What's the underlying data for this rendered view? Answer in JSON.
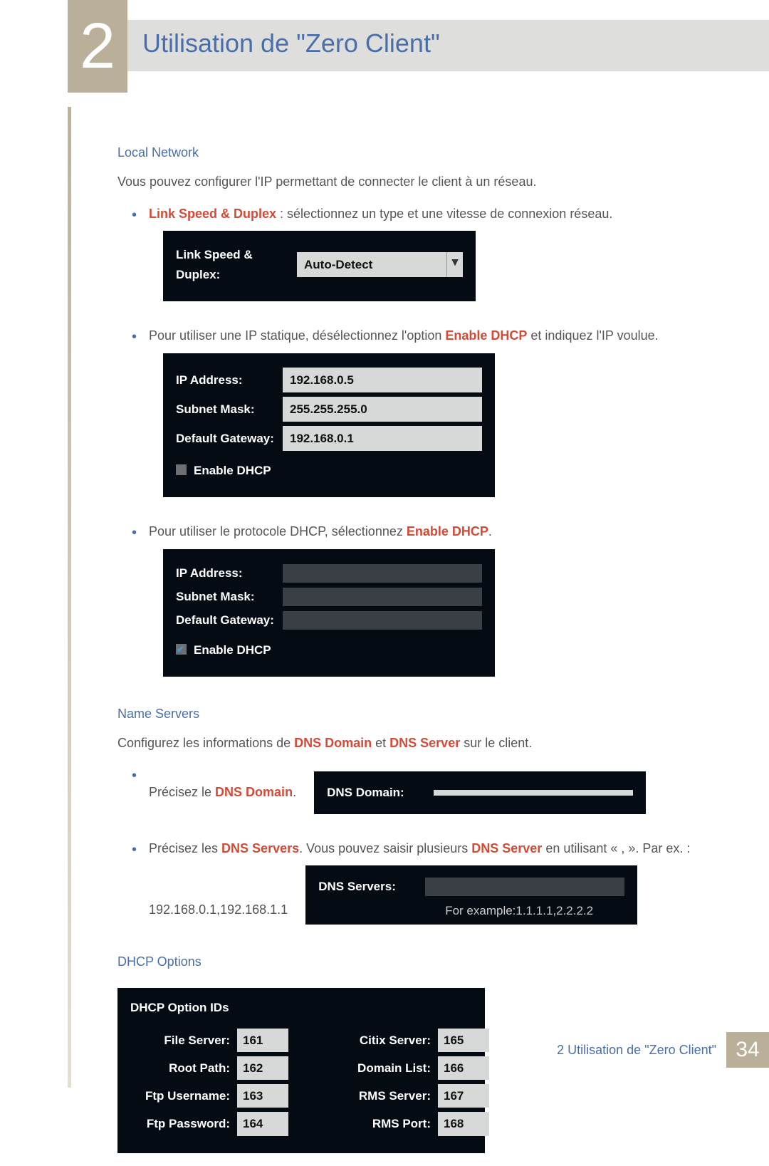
{
  "chapter": {
    "number": "2",
    "title": "Utilisation de \"Zero Client\""
  },
  "section_localnet": {
    "heading": "Local Network",
    "intro": "Vous pouvez configurer l'IP permettant de connecter le client à un réseau.",
    "bullet1_label": "Link Speed & Duplex",
    "bullet1_rest": " : sélectionnez un type et une vitesse de connexion réseau.",
    "ui1": {
      "label": "Link Speed & Duplex:",
      "value": "Auto-Detect"
    },
    "bullet2_pre": "Pour utiliser une IP statique, désélectionnez l'option ",
    "bullet2_red": "Enable DHCP",
    "bullet2_post": " et indiquez l'IP voulue.",
    "ui2": {
      "ip_label": "IP Address:",
      "ip_value": "192.168.0.5",
      "mask_label": "Subnet Mask:",
      "mask_value": "255.255.255.0",
      "gw_label": "Default Gateway:",
      "gw_value": "192.168.0.1",
      "dhcp_label": "Enable DHCP"
    },
    "bullet3_pre": "Pour utiliser le protocole DHCP, sélectionnez ",
    "bullet3_red": "Enable DHCP",
    "bullet3_post": ".",
    "ui3": {
      "ip_label": "IP Address:",
      "mask_label": "Subnet Mask:",
      "gw_label": "Default Gateway:",
      "dhcp_label": "Enable DHCP"
    }
  },
  "section_nameservers": {
    "heading": "Name Servers",
    "intro_pre": "Configurez les informations de ",
    "intro_red1": "DNS Domain",
    "intro_mid": " et ",
    "intro_red2": "DNS Server",
    "intro_post": " sur le client.",
    "bullet1_pre": "Précisez le ",
    "bullet1_red": "DNS Domain",
    "bullet1_post": ".",
    "ui1": {
      "label": "DNS Domain:"
    },
    "bullet2_pre": "Précisez les ",
    "bullet2_red1": "DNS Servers",
    "bullet2_mid": ". Vous pouvez saisir plusieurs ",
    "bullet2_red2": "DNS Server",
    "bullet2_post": " en utilisant « , ». Par ex. : 192.168.0.1,192.168.1.1",
    "ui2": {
      "label": "DNS Servers:",
      "hint": "For example:1.1.1.1,2.2.2.2"
    }
  },
  "section_dhcp": {
    "heading": "DHCP Options",
    "ids_title": "DHCP Option IDs",
    "left": [
      {
        "label": "File Server:",
        "value": "161"
      },
      {
        "label": "Root Path:",
        "value": "162"
      },
      {
        "label": "Ftp Username:",
        "value": "163"
      },
      {
        "label": "Ftp Password:",
        "value": "164"
      }
    ],
    "right": [
      {
        "label": "Citix Server:",
        "value": "165"
      },
      {
        "label": "Domain List:",
        "value": "166"
      },
      {
        "label": "RMS Server:",
        "value": "167"
      },
      {
        "label": "RMS Port:",
        "value": "168"
      }
    ]
  },
  "footer": {
    "text": "2 Utilisation de \"Zero Client\"",
    "page": "34"
  }
}
